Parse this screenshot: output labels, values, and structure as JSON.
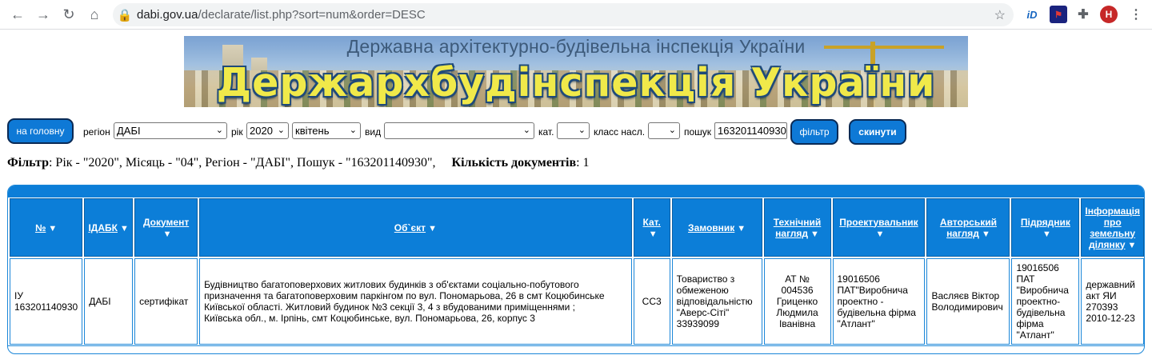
{
  "browser": {
    "url_host": "dabi.gov.ua",
    "url_path": "/declarate/list.php?sort=num&order=DESC",
    "avatar_letter": "H"
  },
  "banner": {
    "subtitle": "Державна архітектурно-будівельна інспекція України",
    "title": "Держархбудінспекція України"
  },
  "filters": {
    "home_button": "на головну",
    "region_label": "регіон",
    "region_value": "ДАБІ",
    "year_label": "рік",
    "year_value": "2020",
    "month_value": "квітень",
    "type_label": "вид",
    "type_value": "",
    "category_label": "кат.",
    "category_value": "",
    "class_label": "класс насл.",
    "class_value": "",
    "search_label": "пошук",
    "search_value": "163201140930",
    "filter_button": "фільтр",
    "reset_button": "скинути"
  },
  "summary": {
    "filter_label": "Фільтр",
    "filter_text": ": Рік - \"2020\", Місяць - \"04\", Регіон - \"ДАБІ\", Пошук - \"163201140930\",",
    "count_label": "Кількість документів",
    "count_text": ": 1"
  },
  "table": {
    "headers": {
      "num": "№",
      "idabk": "ІДАБК",
      "document": "Документ",
      "object": "Об`єкт",
      "category": "Кат.",
      "customer": "Замовник",
      "tech_1": "Технічний",
      "tech_2": "нагляд",
      "designer": "Проектувальник",
      "author_1": "Авторський",
      "author_2": "нагляд",
      "contractor": "Підрядник",
      "land_1": "Інформація",
      "land_2": "про",
      "land_3": "земельну",
      "land_4": "ділянку"
    },
    "row": {
      "num_1": "ІУ",
      "num_2": "163201140930",
      "idabk": "ДАБІ",
      "document": "сертифікат",
      "object_1": "Будівництво багатоповерхових житлових будинків з об'єктами соціально-побутового",
      "object_2": "призначення та багатоповерховим паркінгом по вул. Пономарьова, 26 в смт Коцюбинське",
      "object_3": "Київської області. Житловий будинок №3 секції 3, 4 з вбудованими приміщеннями ;",
      "object_4": "Київська обл., м. Ірпінь, смт Коцюбинське, вул. Пономарьова, 26, корпус 3",
      "category": "СС3",
      "customer_1": "Товариство з",
      "customer_2": "обмеженою",
      "customer_3": "відповідальністю",
      "customer_4": "\"Аверс-Сіті\"",
      "customer_5": "33939099",
      "tech_1": "АТ № 004536",
      "tech_2": "Гриценко",
      "tech_3": "Людмила",
      "tech_4": "Іванівна",
      "designer_1": "19016506",
      "designer_2": "ПАТ\"Виробнича",
      "designer_3": "проектно -",
      "designer_4": "будівельна фірма",
      "designer_5": "\"Атлант\"",
      "author_1": "Васляєв Віктор",
      "author_2": "Володимирович",
      "contractor_1": "19016506",
      "contractor_2": "ПАТ",
      "contractor_3": "\"Виробнича",
      "contractor_4": "проектно-",
      "contractor_5": "будівельна",
      "contractor_6": "фірма",
      "contractor_7": "\"Атлант\"",
      "land_1": "державний",
      "land_2": "акт ЯИ",
      "land_3": "270393",
      "land_4": "2010-12-23"
    }
  }
}
